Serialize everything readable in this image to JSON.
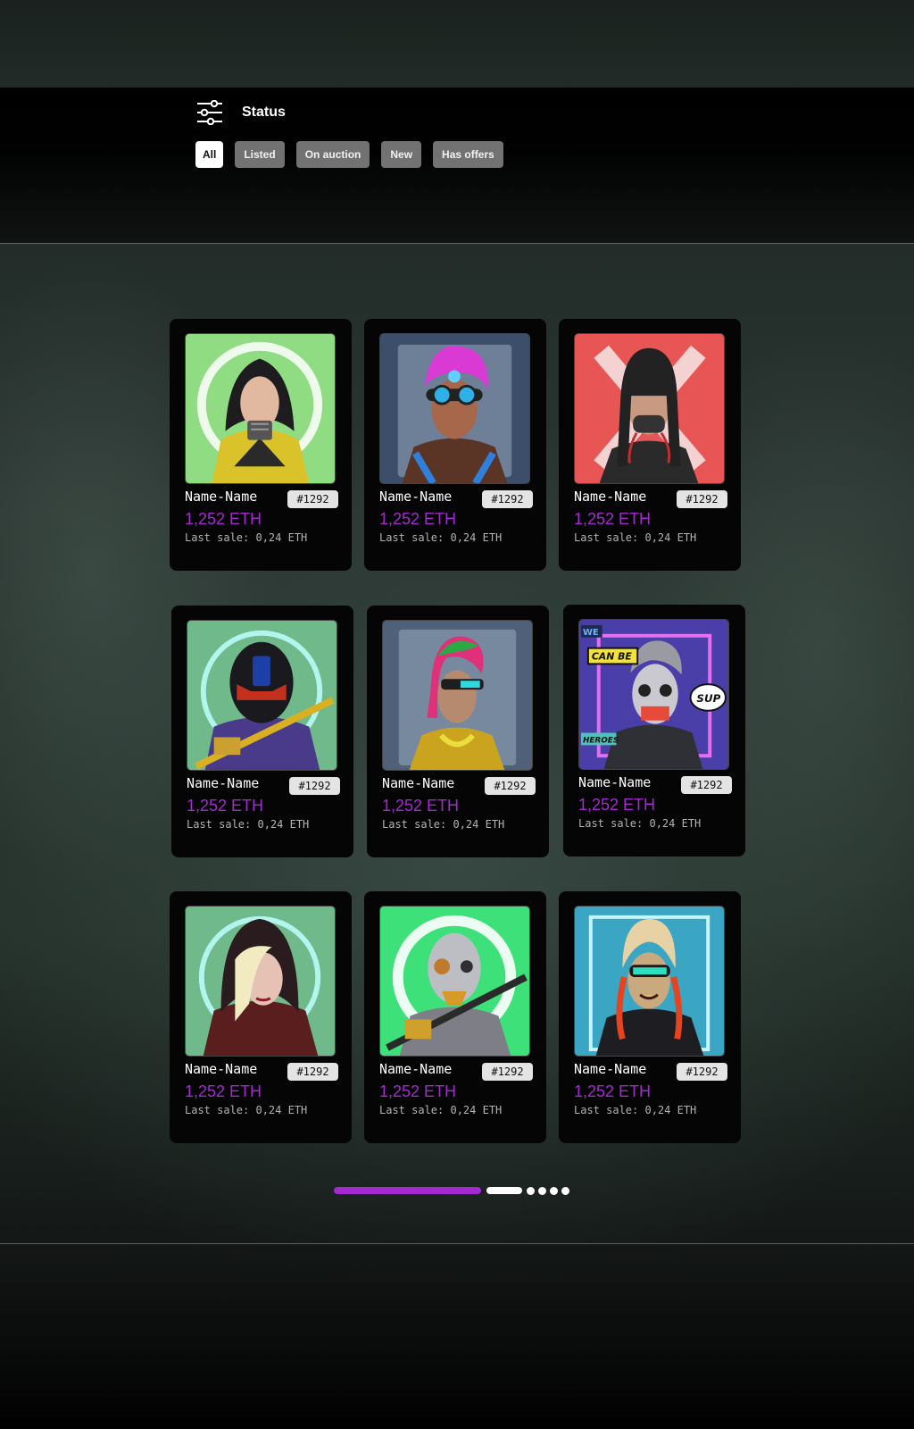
{
  "filter": {
    "title": "Status",
    "icon": "sliders-icon",
    "chips": [
      {
        "label": "All",
        "active": true
      },
      {
        "label": "Listed",
        "active": false
      },
      {
        "label": "On auction",
        "active": false
      },
      {
        "label": "New",
        "active": false
      },
      {
        "label": "Has offers",
        "active": false
      }
    ]
  },
  "colors": {
    "accent": "#a42ad0",
    "card_bg": "#050505",
    "chip_bg": "#727272",
    "chip_active_bg": "#ffffff"
  },
  "cards": [
    {
      "name": "Name-Name",
      "token": "#1292",
      "price": "1,252 ETH",
      "last_sale": "Last sale: 0,24 ETH",
      "art_bg": "#8fdc82",
      "art": "yellow-hooded-cyborg-portrait"
    },
    {
      "name": "Name-Name",
      "token": "#1292",
      "price": "1,252 ETH",
      "last_sale": "Last sale: 0,24 ETH",
      "art_bg": "#3d4e6b",
      "art": "pink-hair-goggles-portrait"
    },
    {
      "name": "Name-Name",
      "token": "#1292",
      "price": "1,252 ETH",
      "last_sale": "Last sale: 0,24 ETH",
      "art_bg": "#e85555",
      "art": "braided-masked-portrait"
    },
    {
      "name": "Name-Name",
      "token": "#1292",
      "price": "1,252 ETH",
      "last_sale": "Last sale: 0,24 ETH",
      "art_bg": "#6fb98a",
      "art": "helmet-sword-portrait"
    },
    {
      "name": "Name-Name",
      "token": "#1292",
      "price": "1,252 ETH",
      "last_sale": "Last sale: 0,24 ETH",
      "art_bg": "#4f6078",
      "art": "green-pink-hair-cyborg-portrait"
    },
    {
      "name": "Name-Name",
      "token": "#1292",
      "price": "1,252 ETH",
      "last_sale": "Last sale: 0,24 ETH",
      "art_bg": "#4a3fa8",
      "art": "comic-skull-mask-portrait",
      "art_text": [
        "WE",
        "CAN BE",
        "HEROES",
        "SUP"
      ]
    },
    {
      "name": "Name-Name",
      "token": "#1292",
      "price": "1,252 ETH",
      "last_sale": "Last sale: 0,24 ETH",
      "art_bg": "#6fb98a",
      "art": "red-hooded-blonde-portrait"
    },
    {
      "name": "Name-Name",
      "token": "#1292",
      "price": "1,252 ETH",
      "last_sale": "Last sale: 0,24 ETH",
      "art_bg": "#3ee07a",
      "art": "silver-robot-sword-portrait"
    },
    {
      "name": "Name-Name",
      "token": "#1292",
      "price": "1,252 ETH",
      "last_sale": "Last sale: 0,24 ETH",
      "art_bg": "#3aa6c4",
      "art": "blonde-visor-portrait"
    }
  ],
  "pagination": {
    "progress": 0.33,
    "pages": 6,
    "current": 2
  }
}
